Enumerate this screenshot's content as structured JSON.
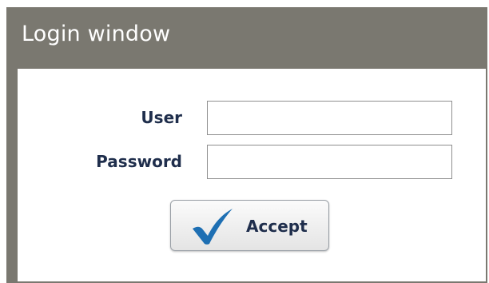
{
  "window": {
    "title": "Login window"
  },
  "form": {
    "user_label": "User",
    "user_value": "",
    "password_label": "Password",
    "password_value": ""
  },
  "accept_button": {
    "label": "Accept",
    "icon": "checkmark-icon",
    "icon_color": "#1e6fb3"
  },
  "colors": {
    "titlebar": "#7a7870",
    "title_text": "#ffffff",
    "label_text": "#1f2e4c"
  }
}
